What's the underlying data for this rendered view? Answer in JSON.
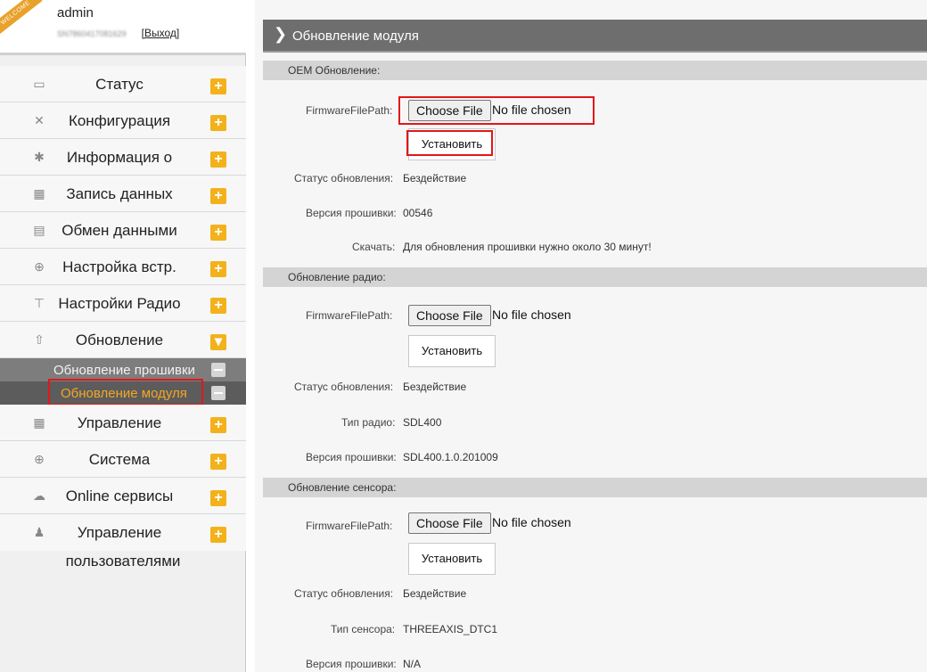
{
  "user": {
    "welcome": "WELCOME",
    "name": "admin",
    "id": "SN7860417081629",
    "logout": "[Выход]"
  },
  "sidebar": {
    "items": [
      {
        "label": "Статус",
        "icon": "monitor-icon"
      },
      {
        "label": "Конфигурация",
        "icon": "tools-icon"
      },
      {
        "label": "Информация о",
        "icon": "satellite-icon"
      },
      {
        "label": "Запись данных",
        "icon": "calendar-icon"
      },
      {
        "label": "Обмен данными",
        "icon": "network-icon"
      },
      {
        "label": "Настройка встр.",
        "icon": "globe-icon"
      },
      {
        "label": "Настройки Радио",
        "icon": "antenna-icon"
      },
      {
        "label": "Обновление",
        "icon": "upload-icon"
      }
    ],
    "submenu": [
      {
        "label": "Обновление прошивки"
      },
      {
        "label": "Обновление модуля"
      }
    ],
    "items_after": [
      {
        "label": "Управление",
        "icon": "calendar-icon"
      },
      {
        "label": "Система",
        "icon": "globe-icon"
      },
      {
        "label": "Online сервисы",
        "icon": "cloud-icon"
      },
      {
        "label": "Управление",
        "icon": "users-icon"
      }
    ],
    "extra_label": "пользователями"
  },
  "main": {
    "title": "Обновление модуля",
    "file_label": "FirmwareFilePath:",
    "choose_file": "Choose File",
    "no_file": "No file chosen",
    "install": "Установить",
    "oem": {
      "section": "OEM Обновление:",
      "status_label": "Статус обновления:",
      "status_value": "Бездействие",
      "version_label": "Версия прошивки:",
      "version_value": "00546",
      "download_label": "Скачать:",
      "download_value": "Для обновления прошивки нужно около 30 минут!"
    },
    "radio": {
      "section": "Обновление радио:",
      "status_label": "Статус обновления:",
      "status_value": "Бездействие",
      "type_label": "Тип радио:",
      "type_value": "SDL400",
      "version_label": "Версия прошивки:",
      "version_value": "SDL400.1.0.201009"
    },
    "sensor": {
      "section": "Обновление сенсора:",
      "status_label": "Статус обновления:",
      "status_value": "Бездействие",
      "type_label": "Тип сенсора:",
      "type_value": "THREEAXIS_DTC1",
      "version_label": "Версия прошивки:",
      "version_value": "N/A"
    }
  }
}
